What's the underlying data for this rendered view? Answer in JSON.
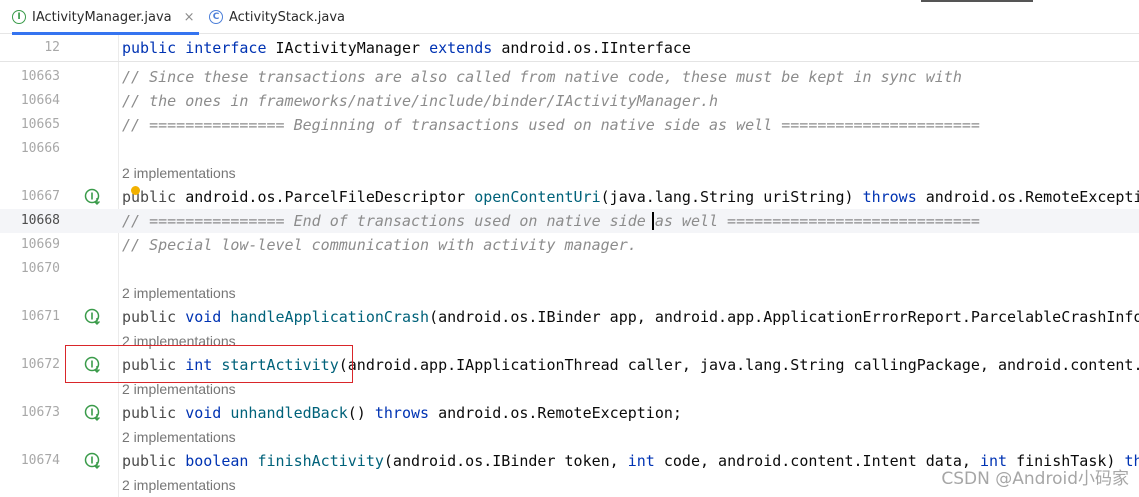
{
  "tabs": [
    {
      "label": "IActivityManager.java",
      "icon": "interface-icon",
      "icon_glyph": "I",
      "active": true,
      "close": "×"
    },
    {
      "label": "ActivityStack.java",
      "icon": "class-icon",
      "icon_glyph": "C",
      "active": false
    }
  ],
  "sticky": {
    "line": "12",
    "code": {
      "kw1": "public",
      "kw2": "interface",
      "name": "IActivityManager",
      "kw3": "extends",
      "base": "android.os.IInterface"
    }
  },
  "lines": {
    "l10663": {
      "num": "10663",
      "text": "// Since these transactions are also called from native code, these must be kept in sync with"
    },
    "l10664": {
      "num": "10664",
      "text": "// the ones in frameworks/native/include/binder/IActivityManager.h"
    },
    "l10665": {
      "num": "10665",
      "text": "// =============== Beginning of transactions used on native side as well ======================"
    },
    "l10666": {
      "num": "10666"
    },
    "l10667": {
      "num": "10667",
      "pub": "public",
      "ret": "android.os.ParcelFileDescriptor",
      "fn": "openContentUri",
      "args": "(java.lang.String uriString) ",
      "throws": "throws",
      "rest": " android.os.RemoteExcepti"
    },
    "l10668": {
      "num": "10668",
      "text": "// =============== End of transactions used on native side as well ============================"
    },
    "l10669": {
      "num": "10669",
      "text": "// Special low-level communication with activity manager."
    },
    "l10670": {
      "num": "10670"
    },
    "l10671": {
      "num": "10671",
      "pub": "public",
      "kw": "void",
      "fn": "handleApplicationCrash",
      "args": "(android.os.IBinder app, android.app.ApplicationErrorReport.ParcelableCrashInfo"
    },
    "l10672": {
      "num": "10672",
      "pub": "public",
      "kw": "int",
      "fn": "startActivity",
      "args": "(android.app.IApplicationThread caller, java.lang.String callingPackage, android.content."
    },
    "l10673": {
      "num": "10673",
      "pub": "public",
      "kw": "void",
      "fn": "unhandledBack",
      "args": "() ",
      "throws": "throws",
      "rest": " android.os.RemoteException;"
    },
    "l10674": {
      "num": "10674",
      "pub": "public",
      "kw": "boolean",
      "fn": "finishActivity",
      "a1": "(android.os.IBinder token, ",
      "k2": "int",
      "a2": " code, android.content.Intent data, ",
      "k3": "int",
      "a3": " finishTask) ",
      "k4": "th"
    }
  },
  "hint": "2 implementations",
  "watermark": "CSDN @Android小码家",
  "colors": {
    "keyword": "#0033b3",
    "function": "#00627a",
    "comment": "#8c8c8c",
    "annotation_box": "#d9262a",
    "gutter_icon": "#3a9b4a"
  }
}
